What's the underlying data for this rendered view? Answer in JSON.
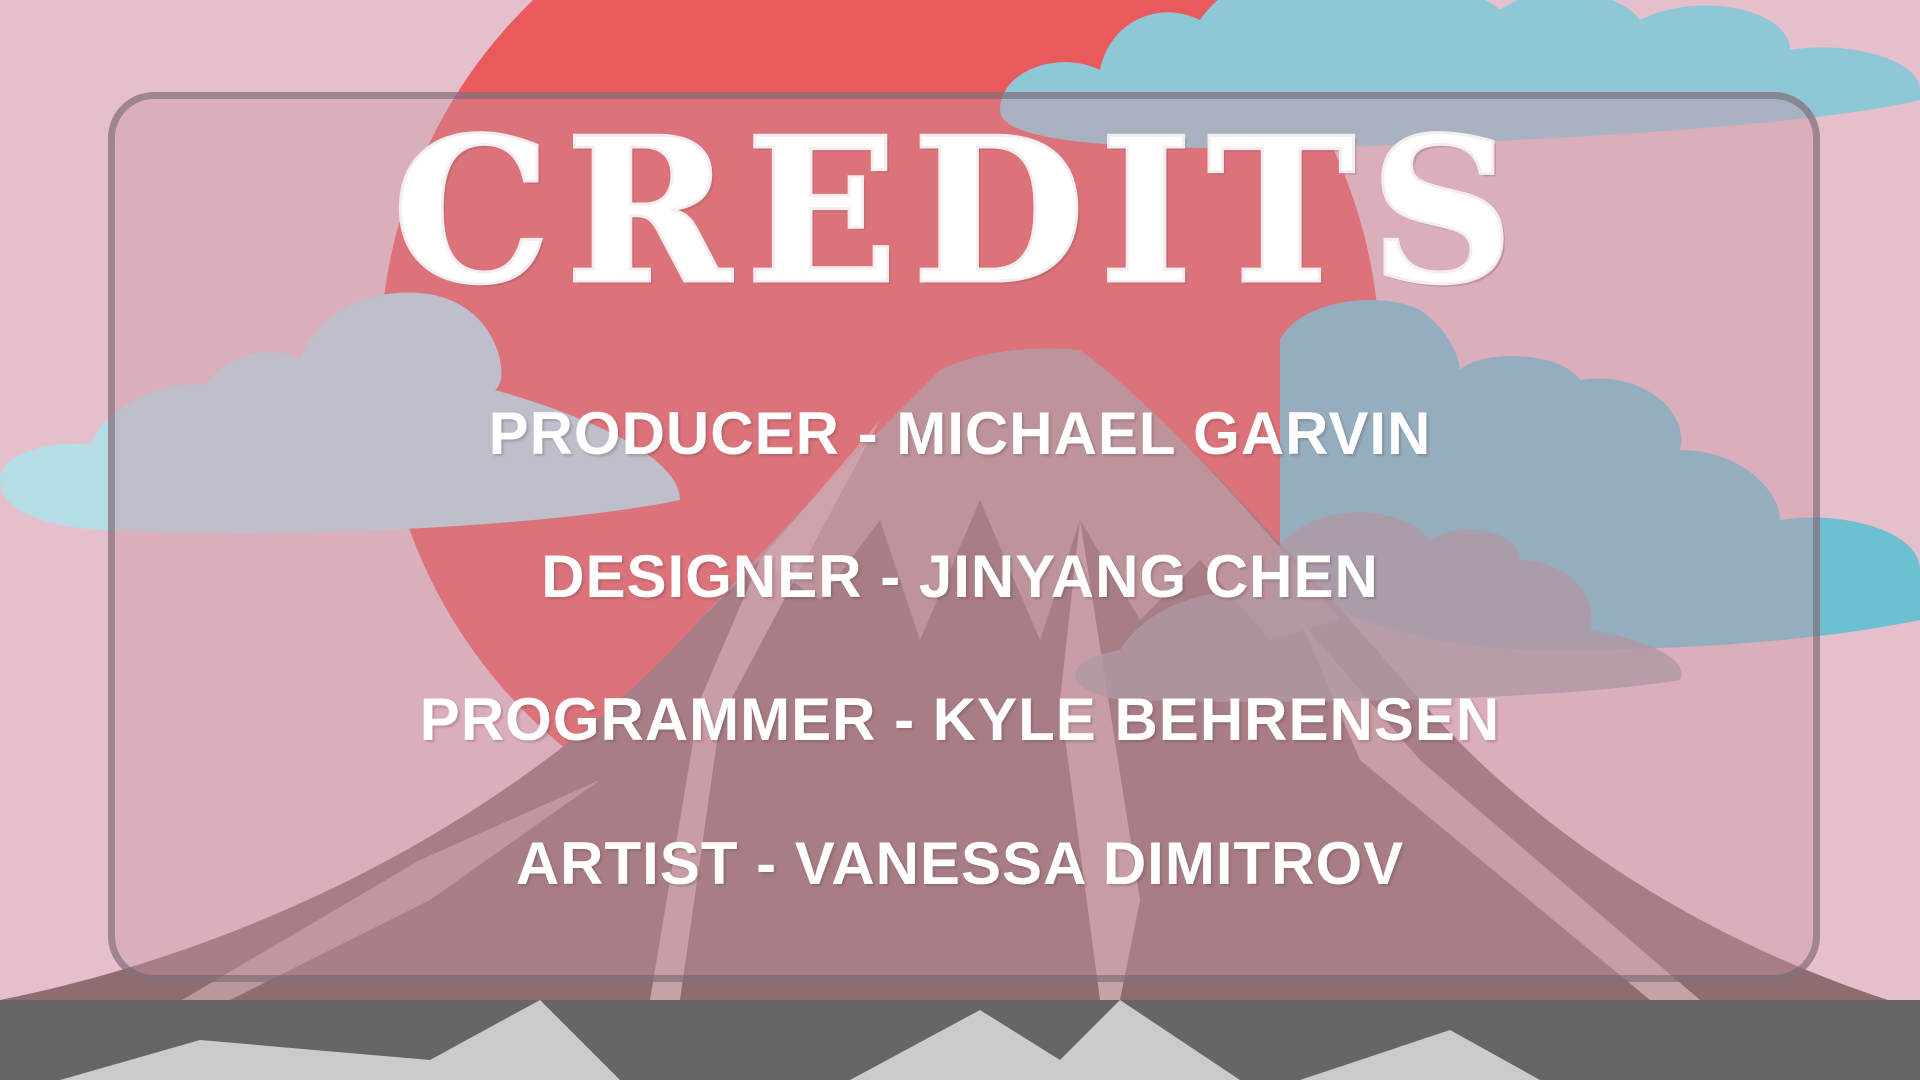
{
  "screen": {
    "title": "CREDITS",
    "credits": [
      "PRODUCER - MICHAEL GARVIN",
      "DESIGNER - JINYANG CHEN",
      "PROGRAMMER - KYLE BEHRENSEN",
      "ARTIST - VANESSA DIMITROV"
    ]
  },
  "colors": {
    "sky": "#e6bfcd",
    "sun": "#e85a5c",
    "cloud_blue": "#8ec7d6",
    "mountain": "#8e6c70",
    "ground": "#666666"
  },
  "icons": [
    "sun",
    "cloud",
    "mountain"
  ]
}
